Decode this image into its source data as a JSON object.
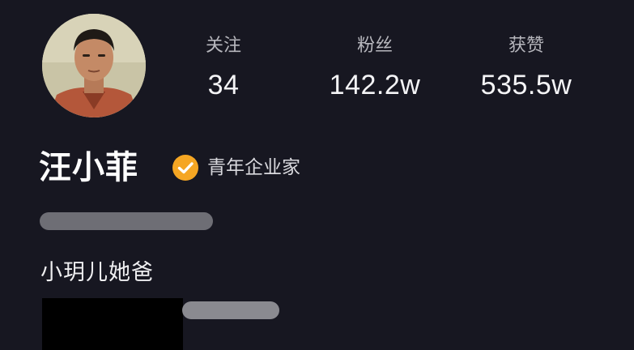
{
  "profile": {
    "avatar_icon": "profile-photo",
    "name": "汪小菲",
    "verification": {
      "icon": "verified-check-icon",
      "color": "#f5a623",
      "label": "青年企业家"
    },
    "bio": "小玥儿她爸"
  },
  "stats": [
    {
      "label": "关注",
      "value": "34"
    },
    {
      "label": "粉丝",
      "value": "142.2w"
    },
    {
      "label": "获赞",
      "value": "535.5w"
    }
  ],
  "colors": {
    "background": "#171721",
    "stat_label": "#b7b7bd",
    "redaction_pill": "#6e6e75",
    "redaction_block": "#000000"
  }
}
